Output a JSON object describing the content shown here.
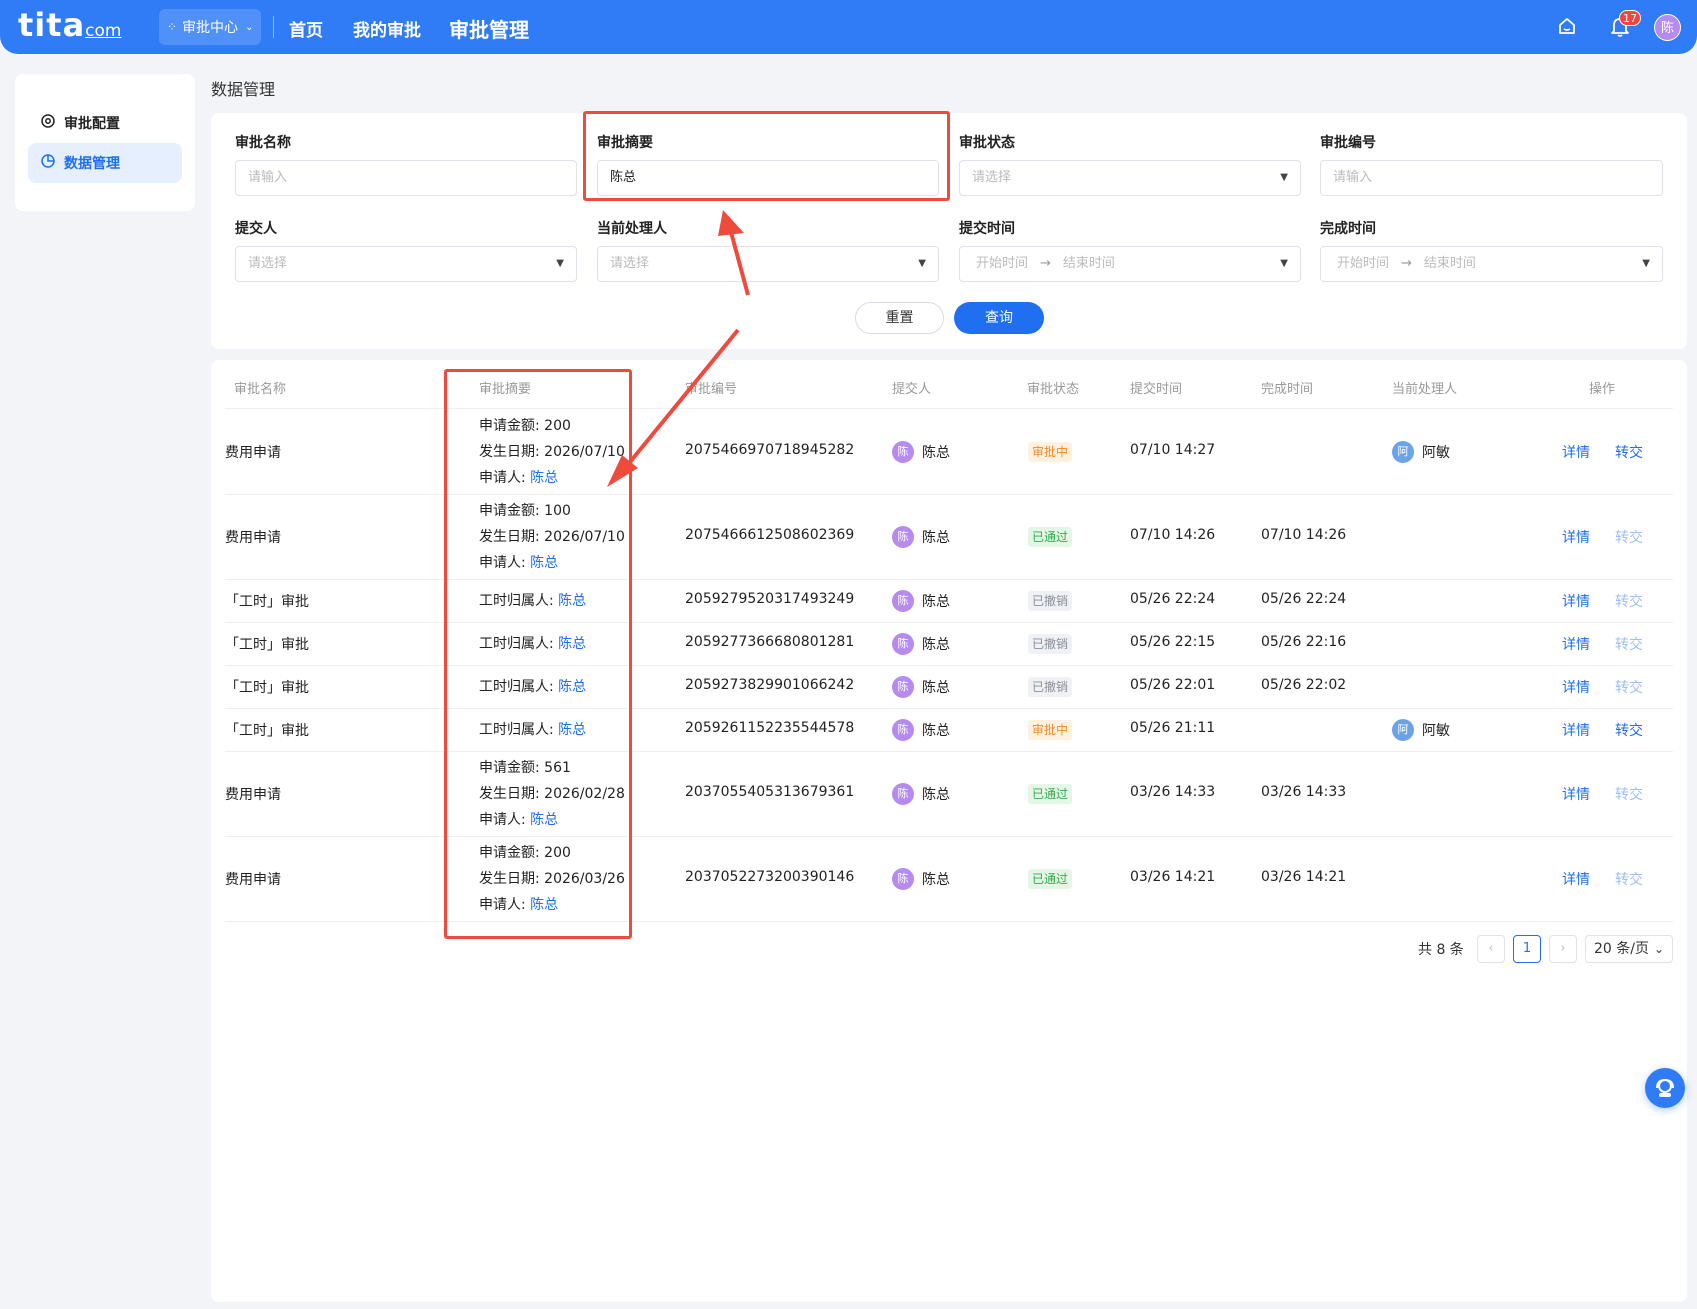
{
  "header": {
    "logo": "tita",
    "logo_suffix": "com",
    "app_switch": "审批中心",
    "nav": [
      "首页",
      "我的审批",
      "审批管理"
    ],
    "notification_count": "17",
    "user_avatar": "陈"
  },
  "sidebar": {
    "items": [
      {
        "label": "审批配置",
        "icon": "settings-icon"
      },
      {
        "label": "数据管理",
        "icon": "pie-chart-icon"
      }
    ]
  },
  "page_title": "数据管理",
  "filters": {
    "name_label": "审批名称",
    "name_placeholder": "请输入",
    "summary_label": "审批摘要",
    "summary_value": "陈总",
    "status_label": "审批状态",
    "status_placeholder": "请选择",
    "number_label": "审批编号",
    "number_placeholder": "请输入",
    "submitter_label": "提交人",
    "submitter_placeholder": "请选择",
    "handler_label": "当前处理人",
    "handler_placeholder": "请选择",
    "submit_time_label": "提交时间",
    "finish_time_label": "完成时间",
    "start_placeholder": "开始时间",
    "end_placeholder": "结束时间",
    "reset": "重置",
    "query": "查询"
  },
  "table": {
    "columns": [
      "审批名称",
      "审批摘要",
      "审批编号",
      "提交人",
      "审批状态",
      "提交时间",
      "完成时间",
      "当前处理人",
      "操作"
    ],
    "rows": [
      {
        "name": "费用申请",
        "summary": [
          [
            "申请金额: 200",
            ""
          ],
          [
            "发生日期: 2026/07/10",
            ""
          ],
          [
            "申请人: ",
            "陈总"
          ]
        ],
        "number": "2075466970718945282",
        "submitter": "陈总",
        "submitter_initial": "陈",
        "status": "审批中",
        "status_type": "pending",
        "submit_time": "07/10 14:27",
        "finish_time": "",
        "handler": "阿敏",
        "handler_initial": "阿",
        "detail": "详情",
        "transfer": "转交",
        "transfer_enabled": true
      },
      {
        "name": "费用申请",
        "summary": [
          [
            "申请金额: 100",
            ""
          ],
          [
            "发生日期: 2026/07/10",
            ""
          ],
          [
            "申请人: ",
            "陈总"
          ]
        ],
        "number": "2075466612508602369",
        "submitter": "陈总",
        "submitter_initial": "陈",
        "status": "已通过",
        "status_type": "approved",
        "submit_time": "07/10 14:26",
        "finish_time": "07/10 14:26",
        "handler": "",
        "handler_initial": "",
        "detail": "详情",
        "transfer": "转交",
        "transfer_enabled": false
      },
      {
        "name": "「工时」审批",
        "summary": [
          [
            "工时归属人: ",
            "陈总"
          ]
        ],
        "number": "2059279520317493249",
        "submitter": "陈总",
        "submitter_initial": "陈",
        "status": "已撤销",
        "status_type": "revoked",
        "submit_time": "05/26 22:24",
        "finish_time": "05/26 22:24",
        "handler": "",
        "handler_initial": "",
        "detail": "详情",
        "transfer": "转交",
        "transfer_enabled": false
      },
      {
        "name": "「工时」审批",
        "summary": [
          [
            "工时归属人: ",
            "陈总"
          ]
        ],
        "number": "2059277366680801281",
        "submitter": "陈总",
        "submitter_initial": "陈",
        "status": "已撤销",
        "status_type": "revoked",
        "submit_time": "05/26 22:15",
        "finish_time": "05/26 22:16",
        "handler": "",
        "handler_initial": "",
        "detail": "详情",
        "transfer": "转交",
        "transfer_enabled": false
      },
      {
        "name": "「工时」审批",
        "summary": [
          [
            "工时归属人: ",
            "陈总"
          ]
        ],
        "number": "2059273829901066242",
        "submitter": "陈总",
        "submitter_initial": "陈",
        "status": "已撤销",
        "status_type": "revoked",
        "submit_time": "05/26 22:01",
        "finish_time": "05/26 22:02",
        "handler": "",
        "handler_initial": "",
        "detail": "详情",
        "transfer": "转交",
        "transfer_enabled": false
      },
      {
        "name": "「工时」审批",
        "summary": [
          [
            "工时归属人: ",
            "陈总"
          ]
        ],
        "number": "2059261152235544578",
        "submitter": "陈总",
        "submitter_initial": "陈",
        "status": "审批中",
        "status_type": "pending",
        "submit_time": "05/26 21:11",
        "finish_time": "",
        "handler": "阿敏",
        "handler_initial": "阿",
        "detail": "详情",
        "transfer": "转交",
        "transfer_enabled": true
      },
      {
        "name": "费用申请",
        "summary": [
          [
            "申请金额: 561",
            ""
          ],
          [
            "发生日期: 2026/02/28",
            ""
          ],
          [
            "申请人: ",
            "陈总"
          ]
        ],
        "number": "2037055405313679361",
        "submitter": "陈总",
        "submitter_initial": "陈",
        "status": "已通过",
        "status_type": "approved",
        "submit_time": "03/26 14:33",
        "finish_time": "03/26 14:33",
        "handler": "",
        "handler_initial": "",
        "detail": "详情",
        "transfer": "转交",
        "transfer_enabled": false
      },
      {
        "name": "费用申请",
        "summary": [
          [
            "申请金额: 200",
            ""
          ],
          [
            "发生日期: 2026/03/26",
            ""
          ],
          [
            "申请人: ",
            "陈总"
          ]
        ],
        "number": "2037052273200390146",
        "submitter": "陈总",
        "submitter_initial": "陈",
        "status": "已通过",
        "status_type": "approved",
        "submit_time": "03/26 14:21",
        "finish_time": "03/26 14:21",
        "handler": "",
        "handler_initial": "",
        "detail": "详情",
        "transfer": "转交",
        "transfer_enabled": false
      }
    ]
  },
  "pagination": {
    "total": "共 8 条",
    "current_page": "1",
    "prev": "‹",
    "next": "›",
    "page_size": "20 条/页"
  },
  "colors": {
    "primary": "#2f7cf6",
    "annotation": "#ef4b3c",
    "pending": "#f08a24",
    "approved": "#2fa94d",
    "revoked": "#8a8f99"
  }
}
